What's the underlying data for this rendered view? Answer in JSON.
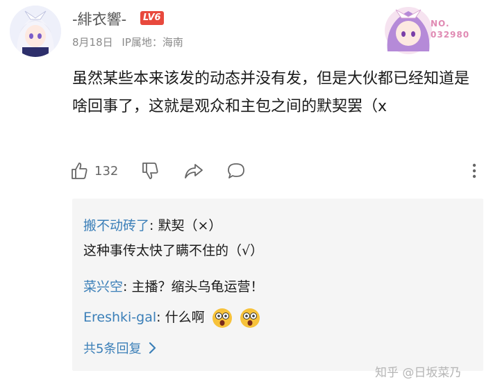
{
  "user": {
    "name": "-緋衣響-",
    "level_badge": "LV6",
    "date": "8月18日",
    "ip": "IP属地：海南"
  },
  "badge_decoration": {
    "line1": "NO.",
    "line2": "032980"
  },
  "comment": {
    "text": "虽然某些本来该发的动态并没有发，但是大伙都已经知道是啥回事了，这就是观众和主包之间的默契罢（x"
  },
  "actions": {
    "like_count": "132"
  },
  "replies": {
    "items": [
      {
        "author": "搬不动砖了",
        "text": ": 默契（×）"
      },
      {
        "author": "",
        "text": "这种事传太快了瞒不住的（√）"
      },
      {
        "author": "菜兴空",
        "text": ": 主播？缩头乌龟运营！"
      },
      {
        "author": "Ereshki-gal",
        "text": ": 什么啊"
      }
    ],
    "more_label": "共5条回复"
  },
  "watermark": "知乎 @日坂菜乃",
  "colors": {
    "accent_blue": "#3b7fb8",
    "level_red": "#e8493d",
    "reply_bg": "#f5f5f5"
  }
}
